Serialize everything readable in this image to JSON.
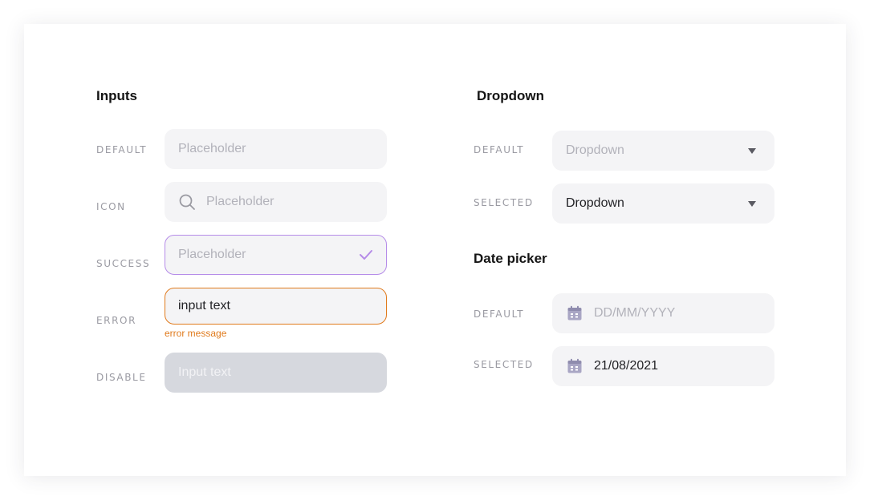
{
  "inputs": {
    "title": "Inputs",
    "rows": [
      {
        "label": "DEFAULT",
        "placeholder": "Placeholder"
      },
      {
        "label": "ICON",
        "placeholder": "Placeholder",
        "icon": "search-icon"
      },
      {
        "label": "SUCCESS",
        "placeholder": "Placeholder",
        "icon": "check-icon"
      },
      {
        "label": "ERROR",
        "value": "input text",
        "error": "error message"
      },
      {
        "label": "DISABLE",
        "placeholder": "Input text"
      }
    ]
  },
  "dropdown": {
    "title": "Dropdown",
    "rows": [
      {
        "label": "DEFAULT",
        "placeholder": "Dropdown",
        "icon": "caret-down-icon"
      },
      {
        "label": "SELECTED",
        "value": "Dropdown",
        "icon": "caret-down-icon"
      }
    ]
  },
  "datepicker": {
    "title": "Date picker",
    "rows": [
      {
        "label": "DEFAULT",
        "placeholder": "DD/MM/YYYY",
        "icon": "calendar-icon"
      },
      {
        "label": "SELECTED",
        "value": "21/08/2021",
        "icon": "calendar-icon"
      }
    ]
  },
  "colors": {
    "field_bg": "#f4f4f6",
    "success": "#b58be8",
    "error": "#e07a1c",
    "disabled": "#d6d8de",
    "calendar_icon": "#a9a6c4"
  }
}
